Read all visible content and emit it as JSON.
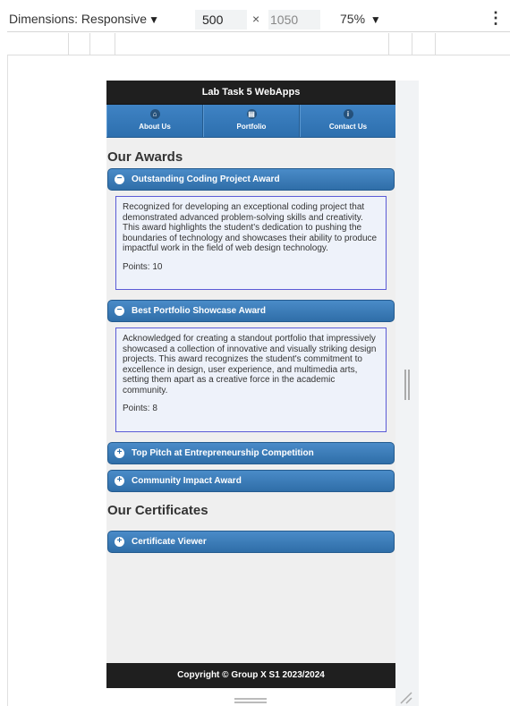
{
  "devtools": {
    "dimensions_label": "Dimensions: Responsive",
    "width_value": "500",
    "times": "×",
    "height_placeholder": "1050",
    "zoom": "75%",
    "menu_glyph": "⋮"
  },
  "app": {
    "title": "Lab Task 5 WebApps",
    "nav": [
      {
        "label": "About Us",
        "icon": "home-icon",
        "glyph": "⌂"
      },
      {
        "label": "Portfolio",
        "icon": "grid-icon",
        "glyph": "▤"
      },
      {
        "label": "Contact Us",
        "icon": "info-icon",
        "glyph": "i"
      }
    ],
    "awards_heading": "Our Awards",
    "awards": [
      {
        "title": "Outstanding Coding Project Award",
        "expanded": true,
        "description": "Recognized for developing an exceptional coding project that demonstrated advanced problem-solving skills and creativity. This award highlights the student's dedication to pushing the boundaries of technology and showcases their ability to produce impactful work in the field of web design technology.",
        "points": "Points: 10"
      },
      {
        "title": "Best Portfolio Showcase Award",
        "expanded": true,
        "description": "Acknowledged for creating a standout portfolio that impressively showcased a collection of innovative and visually striking design projects. This award recognizes the student's commitment to excellence in design, user experience, and multimedia arts, setting them apart as a creative force in the academic community.",
        "points": "Points: 8"
      },
      {
        "title": "Top Pitch at Entrepreneurship Competition",
        "expanded": false
      },
      {
        "title": "Community Impact Award",
        "expanded": false
      }
    ],
    "certificates_heading": "Our Certificates",
    "certificates": [
      {
        "title": "Certificate Viewer",
        "expanded": false
      }
    ],
    "footer": "Copyright © Group X S1 2023/2024",
    "icons": {
      "expanded": "minus-icon",
      "collapsed": "plus-icon",
      "minus_glyph": "−",
      "plus_glyph": "+"
    }
  }
}
